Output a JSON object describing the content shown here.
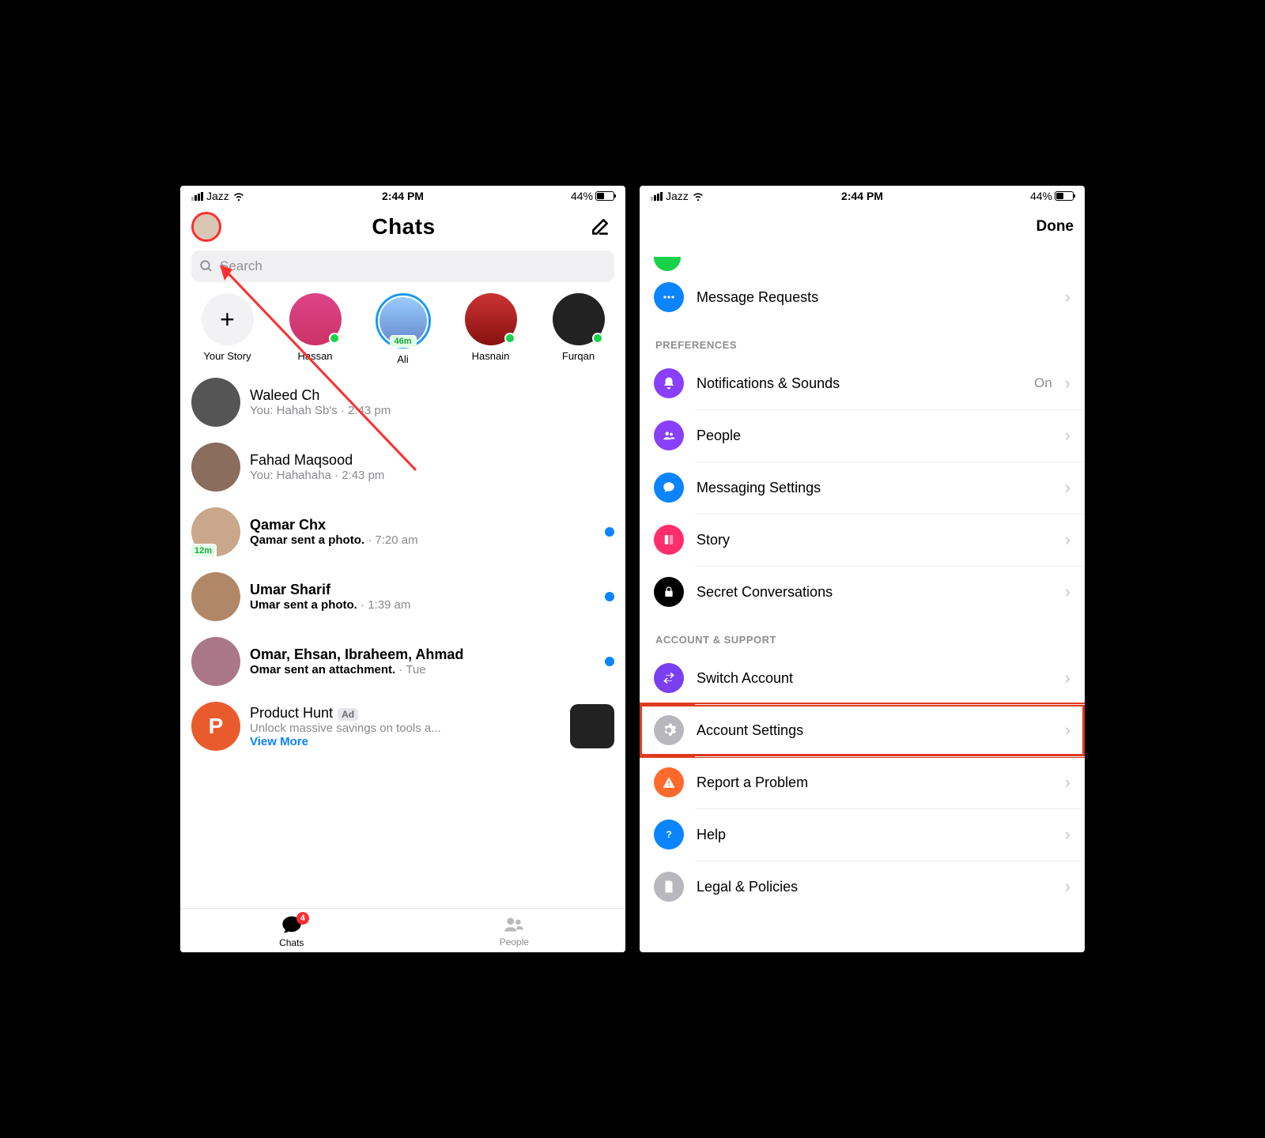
{
  "status": {
    "carrier": "Jazz",
    "time": "2:44 PM",
    "battery": "44%"
  },
  "left": {
    "header_title": "Chats",
    "search_placeholder": "Search",
    "stories": [
      {
        "name": "Your Story"
      },
      {
        "name": "Hassan"
      },
      {
        "name": "Ali",
        "badge": "46m"
      },
      {
        "name": "Hasnain"
      },
      {
        "name": "Furqan"
      }
    ],
    "chats": [
      {
        "name": "Waleed Ch",
        "sub": "You: Hahah Sb's · 2:43 pm"
      },
      {
        "name": "Fahad Maqsood",
        "sub": "You: Hahahaha · 2:43 pm"
      },
      {
        "name": "Qamar Chx",
        "sub_bold": "Qamar sent a photo.",
        "time": " · 7:20 am",
        "badge": "12m"
      },
      {
        "name": "Umar Sharif",
        "sub_bold": "Umar sent a photo.",
        "time": " · 1:39 am"
      },
      {
        "name": "Omar, Ehsan, Ibraheem, Ahmad",
        "sub_bold": "Omar sent an attachment.",
        "time": " · Tue"
      },
      {
        "name": "Product Hunt",
        "sub": "Unlock massive savings on tools a...",
        "view_more": "View More",
        "ad_tag": "Ad"
      }
    ],
    "tabs": {
      "chats": "Chats",
      "chats_badge": "4",
      "people": "People"
    }
  },
  "right": {
    "done": "Done",
    "message_requests": "Message Requests",
    "section_preferences": "PREFERENCES",
    "notifications_label": "Notifications & Sounds",
    "notifications_value": "On",
    "people": "People",
    "messaging_settings": "Messaging Settings",
    "story": "Story",
    "secret": "Secret Conversations",
    "section_account": "ACCOUNT & SUPPORT",
    "switch_account": "Switch Account",
    "account_settings": "Account Settings",
    "report": "Report a Problem",
    "help": "Help",
    "legal": "Legal & Policies"
  }
}
